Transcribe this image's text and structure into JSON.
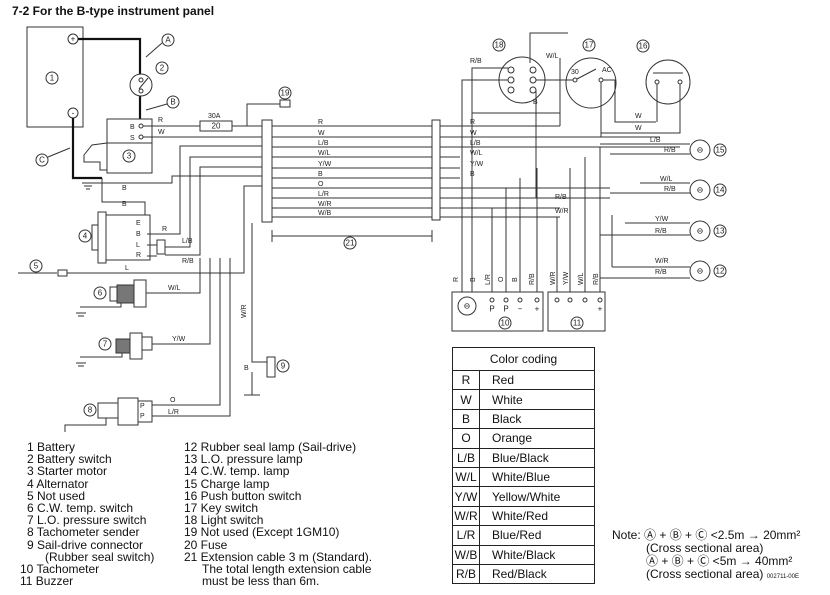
{
  "title": "7-2 For the B-type instrument panel",
  "diagram": {
    "marks": {
      "A": "A",
      "B": "B",
      "C": "C"
    },
    "numbers": [
      "1",
      "2",
      "3",
      "4",
      "5",
      "6",
      "7",
      "8",
      "9",
      "10",
      "11",
      "12",
      "13",
      "14",
      "15",
      "16",
      "17",
      "18",
      "19",
      "20",
      "21"
    ],
    "fuse_rating": "30A",
    "starter_terminals": [
      "B",
      "S"
    ],
    "alternator_terminals": [
      "E",
      "B",
      "L",
      "R"
    ],
    "key_switch_terminals": [
      "30",
      "AC"
    ],
    "tacho_terminals": [
      "P",
      "P",
      "−",
      "+"
    ],
    "buzzer_terminals": [
      "+"
    ],
    "harness_wires": [
      "R",
      "W",
      "L/B",
      "W/L",
      "Y/W",
      "B",
      "O",
      "L/R",
      "W/R",
      "W/B"
    ],
    "left_wires": {
      "r1": "R",
      "w1": "W",
      "b1": "B",
      "b2": "B",
      "r2": "R",
      "lb": "L/B",
      "rb": "R/B",
      "l": "L",
      "wl": "W/L",
      "yw": "Y/W",
      "o": "O",
      "lr": "L/R",
      "wr": "W/R",
      "b3": "B"
    },
    "right_wires": {
      "rb_top": "R/B",
      "wl_top": "W/L",
      "b_mid": "B",
      "w1": "W",
      "w2": "W",
      "lb": "L/B",
      "rb15": "R/B",
      "wl14": "W/L",
      "rb14": "R/B",
      "rb_mid": "R/B",
      "wr_mid": "W/R",
      "yw13": "Y/W",
      "rb13": "R/B",
      "wr12": "W/R",
      "rb12": "R/B"
    },
    "vertical_wires": [
      "R",
      "B",
      "L/R",
      "O",
      "B",
      "R/B",
      "W/R",
      "Y/W",
      "W/L",
      "R/B"
    ]
  },
  "legend_left": [
    "1 Battery",
    "2 Battery switch",
    "3 Starter motor",
    "4 Alternator",
    "5 Not used",
    "6 C.W. temp. switch",
    "7 L.O. pressure switch",
    "8 Tachometer sender",
    "9 Sail-drive connector",
    "(Rubber seal switch)",
    "10 Tachometer",
    "11 Buzzer"
  ],
  "legend_right": [
    "12 Rubber seal lamp (Sail-drive)",
    "13 L.O. pressure lamp",
    "14 C.W. temp. lamp",
    "15 Charge lamp",
    "16 Push button switch",
    "17 Key switch",
    "18 Light switch",
    "19 Not used (Except 1GM10)",
    "20 Fuse",
    "21 Extension cable 3 m (Standard).",
    "The total length extension cable",
    "must be less than 6m."
  ],
  "color_coding": {
    "header": "Color coding",
    "rows": [
      {
        "code": "R",
        "name": "Red"
      },
      {
        "code": "W",
        "name": "White"
      },
      {
        "code": "B",
        "name": "Black"
      },
      {
        "code": "O",
        "name": "Orange"
      },
      {
        "code": "L/B",
        "name": "Blue/Black"
      },
      {
        "code": "W/L",
        "name": "White/Blue"
      },
      {
        "code": "Y/W",
        "name": "Yellow/White"
      },
      {
        "code": "W/R",
        "name": "White/Red"
      },
      {
        "code": "L/R",
        "name": "Blue/Red"
      },
      {
        "code": "W/B",
        "name": "White/Black"
      },
      {
        "code": "R/B",
        "name": "Red/Black"
      }
    ]
  },
  "note": {
    "label": "Note:",
    "line1": "Ⓐ + Ⓑ + Ⓒ <2.5m → 20mm²",
    "line2": "(Cross sectional area)",
    "line3": "Ⓐ + Ⓑ + Ⓒ <5m → 40mm²",
    "line4": "(Cross sectional area)",
    "code": "002711-00E"
  }
}
